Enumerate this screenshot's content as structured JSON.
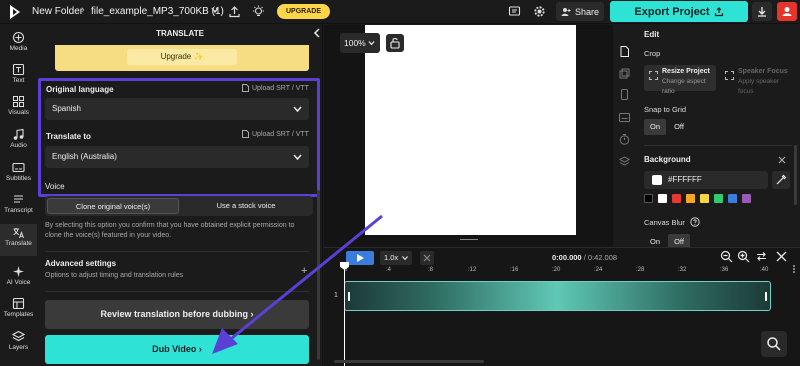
{
  "topbar": {
    "folder": "New Folder",
    "separator": "›",
    "file_name": "file_example_MP3_700KB (1)",
    "upgrade_label": "UPGRADE",
    "share_label": "Share",
    "export_label": "Export Project",
    "accent_color": "#2ee2d6"
  },
  "leftnav": {
    "items": [
      {
        "label": "Media",
        "icon": "media-icon"
      },
      {
        "label": "Text",
        "icon": "text-icon"
      },
      {
        "label": "Visuals",
        "icon": "visuals-icon"
      },
      {
        "label": "Audio",
        "icon": "audio-icon"
      },
      {
        "label": "Subtitles",
        "icon": "subtitles-icon"
      },
      {
        "label": "Transcript",
        "icon": "transcript-icon"
      },
      {
        "label": "Translate",
        "icon": "translate-icon"
      },
      {
        "label": "AI Voice",
        "icon": "ai-voice-icon"
      },
      {
        "label": "Templates",
        "icon": "templates-icon"
      },
      {
        "label": "Layers",
        "icon": "layers-icon"
      }
    ]
  },
  "panel": {
    "title": "TRANSLATE",
    "upgrade_banner": "Upgrade ✨",
    "original_language_label": "Original language",
    "upload_srt_label": "Upload SRT / VTT",
    "original_language_value": "Spanish",
    "translate_to_label": "Translate to",
    "translate_to_value": "English (Australia)",
    "voice_label": "Voice",
    "voice_option_clone": "Clone original voice(s)",
    "voice_option_stock": "Use a stock voice",
    "voice_note": "By selecting this option you confirm that you have obtained explicit permission to clone the voice(s) featured in your video.",
    "advanced_title": "Advanced settings",
    "advanced_desc": "Options to adjust timing and translation rules",
    "review_button": "Review translation before dubbing  ›",
    "dub_button": "Dub Video  ›",
    "highlight_color": "#5b3fd6"
  },
  "stage": {
    "zoom": "100%"
  },
  "edit": {
    "title": "Edit",
    "crop_label": "Crop",
    "resize_title": "Resize Project",
    "resize_sub": "Change aspect ratio",
    "speaker_title": "Speaker Focus",
    "speaker_sub": "Apply speaker focus",
    "snap_label": "Snap to Grid",
    "snap_on": "On",
    "snap_off": "Off",
    "background_label": "Background",
    "background_value": "#FFFFFF",
    "swatches": [
      "#000000",
      "#ffffff",
      "#e53935",
      "#f6a623",
      "#f5d742",
      "#2ecc71",
      "#3b7ddd",
      "#9b59b6"
    ],
    "blur_label": "Canvas Blur",
    "blur_on": "On",
    "blur_off": "Off"
  },
  "timeline": {
    "speed": "1.0x",
    "current_time": "0:00.000",
    "total_time": "/ 0:42.008",
    "track_number": "1",
    "ticks": [
      "0",
      ":4",
      ":8",
      ":12",
      ":16",
      ":20",
      ":24",
      ":28",
      ":32",
      ":36",
      ":40"
    ]
  }
}
